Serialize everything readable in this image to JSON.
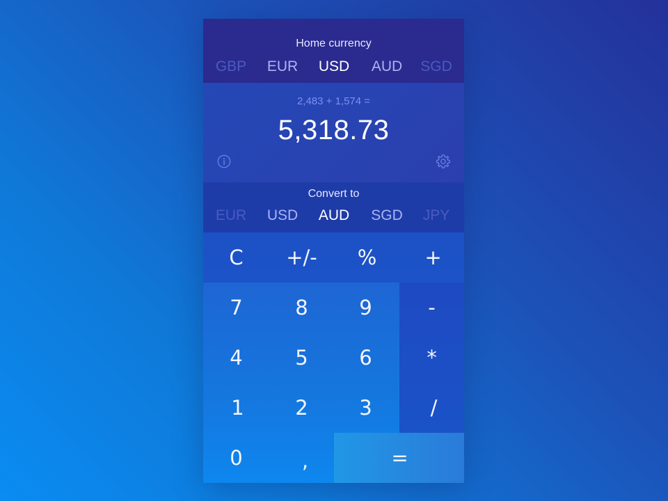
{
  "home": {
    "title": "Home currency",
    "currencies": [
      {
        "code": "GBP",
        "state": "faded"
      },
      {
        "code": "EUR",
        "state": "dim"
      },
      {
        "code": "USD",
        "state": "selected"
      },
      {
        "code": "AUD",
        "state": "dim"
      },
      {
        "code": "SGD",
        "state": "faded"
      }
    ],
    "selected": "USD"
  },
  "display": {
    "expression": "2,483 + 1,574 =",
    "result": "5,318.73",
    "info_icon": "info-icon",
    "settings_icon": "gear-icon"
  },
  "convert": {
    "title": "Convert to",
    "currencies": [
      {
        "code": "EUR",
        "state": "faded"
      },
      {
        "code": "USD",
        "state": "dim"
      },
      {
        "code": "AUD",
        "state": "selected"
      },
      {
        "code": "SGD",
        "state": "dim"
      },
      {
        "code": "JPY",
        "state": "faded"
      }
    ],
    "selected": "AUD"
  },
  "keypad": {
    "function_row": [
      "C",
      "+/-",
      "%",
      "+"
    ],
    "digits": [
      "7",
      "8",
      "9",
      "4",
      "5",
      "6",
      "1",
      "2",
      "3",
      "0",
      ","
    ],
    "operators": [
      "-",
      "*",
      "/"
    ],
    "equals": "="
  },
  "colors": {
    "background_start": "#0a8cf2",
    "background_end": "#24319a",
    "selected_text": "#ffffff",
    "dim_text": "#aab4f2",
    "faded_text": "#4a5bc0"
  }
}
